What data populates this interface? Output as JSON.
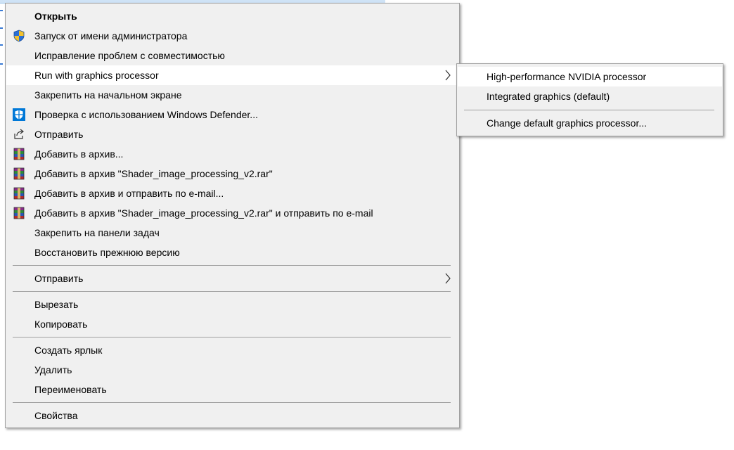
{
  "menu": {
    "items": [
      {
        "label": "Открыть",
        "icon": ""
      },
      {
        "label": "Запуск от имени администратора",
        "icon": "uac-shield-icon"
      },
      {
        "label": "Исправление проблем с совместимостью",
        "icon": ""
      },
      {
        "label": "Run with graphics processor",
        "icon": "",
        "submenu": true
      },
      {
        "label": "Закрепить на начальном экране",
        "icon": ""
      },
      {
        "label": "Проверка с использованием Windows Defender...",
        "icon": "defender-shield-icon"
      },
      {
        "label": "Отправить",
        "icon": "share-icon"
      },
      {
        "label": "Добавить в архив...",
        "icon": "winrar-icon"
      },
      {
        "label": "Добавить в архив \"Shader_image_processing_v2.rar\"",
        "icon": "winrar-icon"
      },
      {
        "label": "Добавить в архив и отправить по e-mail...",
        "icon": "winrar-icon"
      },
      {
        "label": "Добавить в архив \"Shader_image_processing_v2.rar\" и отправить по e-mail",
        "icon": "winrar-icon"
      },
      {
        "label": "Закрепить на панели задач",
        "icon": ""
      },
      {
        "label": "Восстановить прежнюю версию",
        "icon": ""
      },
      {
        "label": "Отправить",
        "icon": "",
        "submenu": true
      },
      {
        "label": "Вырезать",
        "icon": ""
      },
      {
        "label": "Копировать",
        "icon": ""
      },
      {
        "label": "Создать ярлык",
        "icon": ""
      },
      {
        "label": "Удалить",
        "icon": ""
      },
      {
        "label": "Переименовать",
        "icon": ""
      },
      {
        "label": "Свойства",
        "icon": ""
      }
    ]
  },
  "submenu": {
    "items": [
      {
        "label": "High-performance NVIDIA processor"
      },
      {
        "label": "Integrated graphics (default)"
      },
      {
        "label": "Change default graphics processor..."
      }
    ]
  },
  "colors": {
    "menu_bg": "#f0f0f0",
    "highlight": "#ffffff",
    "separator": "#a0a0a0",
    "defender_blue": "#0078d7"
  }
}
